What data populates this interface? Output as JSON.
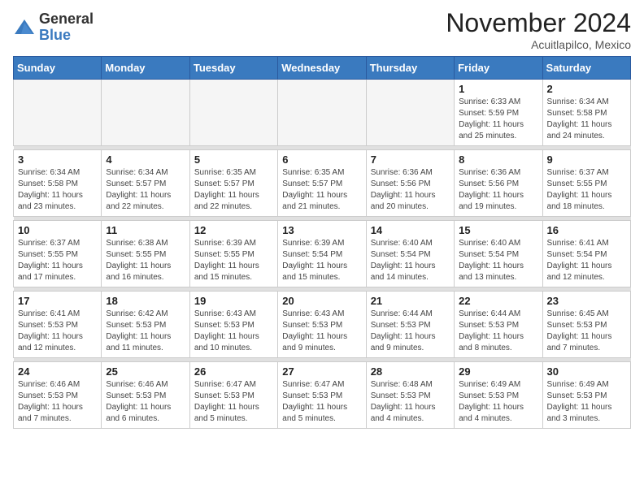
{
  "logo": {
    "general": "General",
    "blue": "Blue"
  },
  "header": {
    "month_title": "November 2024",
    "location": "Acuitlapilco, Mexico"
  },
  "weekdays": [
    "Sunday",
    "Monday",
    "Tuesday",
    "Wednesday",
    "Thursday",
    "Friday",
    "Saturday"
  ],
  "weeks": [
    [
      {
        "day": "",
        "info": ""
      },
      {
        "day": "",
        "info": ""
      },
      {
        "day": "",
        "info": ""
      },
      {
        "day": "",
        "info": ""
      },
      {
        "day": "",
        "info": ""
      },
      {
        "day": "1",
        "info": "Sunrise: 6:33 AM\nSunset: 5:59 PM\nDaylight: 11 hours and 25 minutes."
      },
      {
        "day": "2",
        "info": "Sunrise: 6:34 AM\nSunset: 5:58 PM\nDaylight: 11 hours and 24 minutes."
      }
    ],
    [
      {
        "day": "3",
        "info": "Sunrise: 6:34 AM\nSunset: 5:58 PM\nDaylight: 11 hours and 23 minutes."
      },
      {
        "day": "4",
        "info": "Sunrise: 6:34 AM\nSunset: 5:57 PM\nDaylight: 11 hours and 22 minutes."
      },
      {
        "day": "5",
        "info": "Sunrise: 6:35 AM\nSunset: 5:57 PM\nDaylight: 11 hours and 22 minutes."
      },
      {
        "day": "6",
        "info": "Sunrise: 6:35 AM\nSunset: 5:57 PM\nDaylight: 11 hours and 21 minutes."
      },
      {
        "day": "7",
        "info": "Sunrise: 6:36 AM\nSunset: 5:56 PM\nDaylight: 11 hours and 20 minutes."
      },
      {
        "day": "8",
        "info": "Sunrise: 6:36 AM\nSunset: 5:56 PM\nDaylight: 11 hours and 19 minutes."
      },
      {
        "day": "9",
        "info": "Sunrise: 6:37 AM\nSunset: 5:55 PM\nDaylight: 11 hours and 18 minutes."
      }
    ],
    [
      {
        "day": "10",
        "info": "Sunrise: 6:37 AM\nSunset: 5:55 PM\nDaylight: 11 hours and 17 minutes."
      },
      {
        "day": "11",
        "info": "Sunrise: 6:38 AM\nSunset: 5:55 PM\nDaylight: 11 hours and 16 minutes."
      },
      {
        "day": "12",
        "info": "Sunrise: 6:39 AM\nSunset: 5:55 PM\nDaylight: 11 hours and 15 minutes."
      },
      {
        "day": "13",
        "info": "Sunrise: 6:39 AM\nSunset: 5:54 PM\nDaylight: 11 hours and 15 minutes."
      },
      {
        "day": "14",
        "info": "Sunrise: 6:40 AM\nSunset: 5:54 PM\nDaylight: 11 hours and 14 minutes."
      },
      {
        "day": "15",
        "info": "Sunrise: 6:40 AM\nSunset: 5:54 PM\nDaylight: 11 hours and 13 minutes."
      },
      {
        "day": "16",
        "info": "Sunrise: 6:41 AM\nSunset: 5:54 PM\nDaylight: 11 hours and 12 minutes."
      }
    ],
    [
      {
        "day": "17",
        "info": "Sunrise: 6:41 AM\nSunset: 5:53 PM\nDaylight: 11 hours and 12 minutes."
      },
      {
        "day": "18",
        "info": "Sunrise: 6:42 AM\nSunset: 5:53 PM\nDaylight: 11 hours and 11 minutes."
      },
      {
        "day": "19",
        "info": "Sunrise: 6:43 AM\nSunset: 5:53 PM\nDaylight: 11 hours and 10 minutes."
      },
      {
        "day": "20",
        "info": "Sunrise: 6:43 AM\nSunset: 5:53 PM\nDaylight: 11 hours and 9 minutes."
      },
      {
        "day": "21",
        "info": "Sunrise: 6:44 AM\nSunset: 5:53 PM\nDaylight: 11 hours and 9 minutes."
      },
      {
        "day": "22",
        "info": "Sunrise: 6:44 AM\nSunset: 5:53 PM\nDaylight: 11 hours and 8 minutes."
      },
      {
        "day": "23",
        "info": "Sunrise: 6:45 AM\nSunset: 5:53 PM\nDaylight: 11 hours and 7 minutes."
      }
    ],
    [
      {
        "day": "24",
        "info": "Sunrise: 6:46 AM\nSunset: 5:53 PM\nDaylight: 11 hours and 7 minutes."
      },
      {
        "day": "25",
        "info": "Sunrise: 6:46 AM\nSunset: 5:53 PM\nDaylight: 11 hours and 6 minutes."
      },
      {
        "day": "26",
        "info": "Sunrise: 6:47 AM\nSunset: 5:53 PM\nDaylight: 11 hours and 5 minutes."
      },
      {
        "day": "27",
        "info": "Sunrise: 6:47 AM\nSunset: 5:53 PM\nDaylight: 11 hours and 5 minutes."
      },
      {
        "day": "28",
        "info": "Sunrise: 6:48 AM\nSunset: 5:53 PM\nDaylight: 11 hours and 4 minutes."
      },
      {
        "day": "29",
        "info": "Sunrise: 6:49 AM\nSunset: 5:53 PM\nDaylight: 11 hours and 4 minutes."
      },
      {
        "day": "30",
        "info": "Sunrise: 6:49 AM\nSunset: 5:53 PM\nDaylight: 11 hours and 3 minutes."
      }
    ]
  ]
}
